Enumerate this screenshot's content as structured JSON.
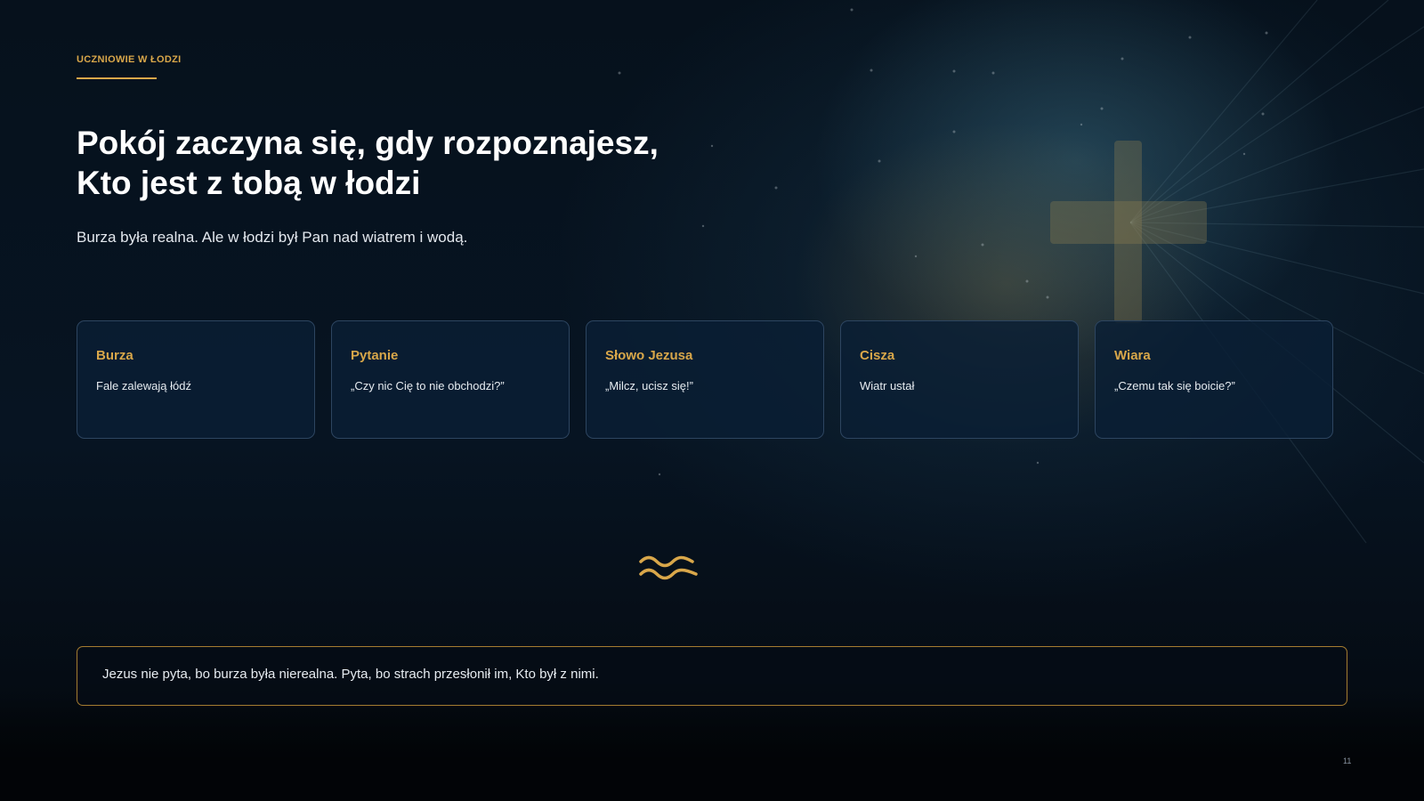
{
  "slide": {
    "eyebrow": "UCZNIOWIE W ŁODZI",
    "title_line1": "Pokój zaczyna się, gdy rozpoznajesz,",
    "title_line2": "Kto jest z tobą w łodzi",
    "subtitle": "Burza była realna. Ale w łodzi był Pan nad wiatrem i wodą.",
    "cards": [
      {
        "title": "Burza",
        "text": "Fale zalewają łódź"
      },
      {
        "title": "Pytanie",
        "text": "„Czy nic Cię to nie obchodzi?”"
      },
      {
        "title": "Słowo Jezusa",
        "text": "„Milcz, ucisz się!”"
      },
      {
        "title": "Cisza",
        "text": "Wiatr ustał"
      },
      {
        "title": "Wiara",
        "text": "„Czemu tak się boicie?”"
      }
    ],
    "divider_icon": "waves-icon",
    "quote": "Jezus nie pyta, bo burza była nierealna. Pyta, bo strach przesłonił im, Kto był z nimi.",
    "page_number": "11"
  },
  "colors": {
    "accent": "#d9a74a",
    "background": "#06111c",
    "card_border": "#2d4560",
    "quote_border": "#a57c30",
    "text": "#ffffff"
  }
}
